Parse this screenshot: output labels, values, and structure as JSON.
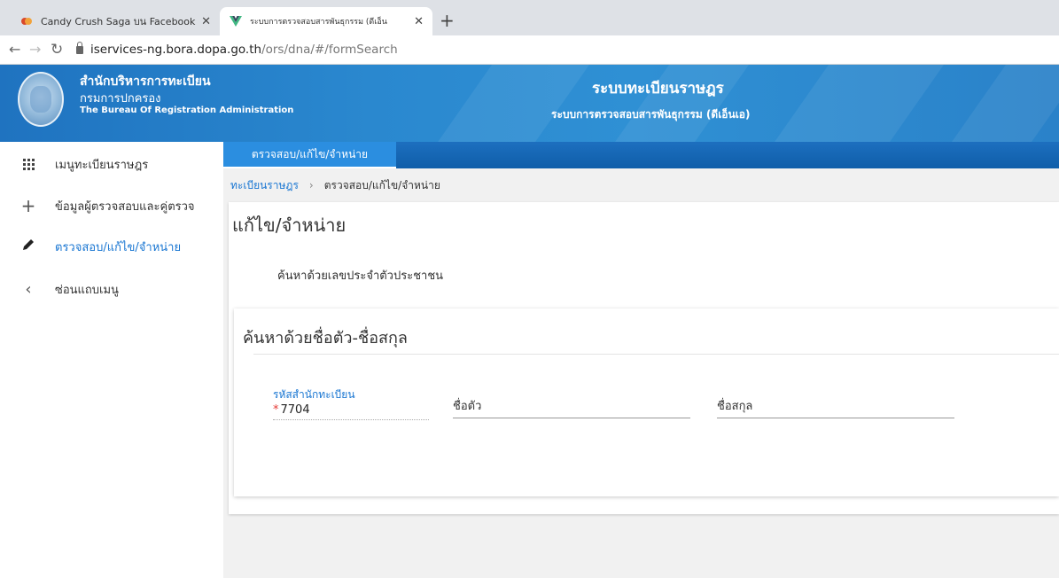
{
  "browser": {
    "tabs": [
      {
        "title": "Candy Crush Saga บน Facebook",
        "favicon": "candy-crush-icon"
      },
      {
        "title": "ระบบการตรวจสอบสารพันธุกรรม (ดีเอ็น",
        "favicon": "vue-logo-icon"
      }
    ],
    "url_host": "iservices-ng.bora.dopa.go.th",
    "url_path": "/ors/dna/#/formSearch"
  },
  "header": {
    "org_line1": "สำนักบริหารการทะเบียน",
    "org_line2": "กรมการปกครอง",
    "org_line3": "The Bureau Of Registration Administration",
    "system_title": "ระบบทะเบียนราษฎร",
    "system_subtitle": "ระบบการตรวจสอบสารพันธุกรรม (ดีเอ็นเอ)"
  },
  "sidebar": {
    "items": [
      {
        "label": "เมนูทะเบียนราษฎร",
        "icon": "grid-icon"
      },
      {
        "label": "ข้อมูลผู้ตรวจสอบและคู่ตรวจ",
        "icon": "plus-icon"
      },
      {
        "label": "ตรวจสอบ/แก้ไข/จำหน่าย",
        "icon": "pencil-icon",
        "active": true
      },
      {
        "label": "ซ่อนแถบเมนู",
        "icon": "chevron-left-icon"
      }
    ]
  },
  "navbar": {
    "active_tab": "ตรวจสอบ/แก้ไข/จำหน่าย"
  },
  "breadcrumb": {
    "root": "ทะเบียนราษฎร",
    "current": "ตรวจสอบ/แก้ไข/จำหน่าย"
  },
  "page": {
    "title": "แก้ไข/จำหน่าย",
    "search_by_id": "ค้นหาด้วยเลขประจำตัวประชาชน",
    "search_by_name": {
      "title": "ค้นหาด้วยชื่อตัว-ชื่อสกุล",
      "office_code_label": "รหัสสำนักทะเบียน",
      "office_code_value": "7704",
      "firstname_placeholder": "ชื่อตัว",
      "lastname_placeholder": "ชื่อสกุล"
    }
  },
  "colors": {
    "primary": "#1976d2",
    "header_blue": "#2a88cf",
    "required": "#e53935"
  }
}
